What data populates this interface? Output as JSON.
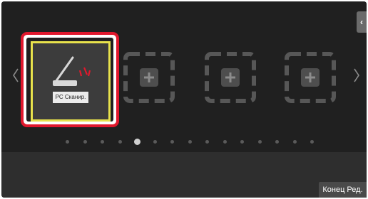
{
  "side_tab": {
    "glyph": "‹",
    "icon": "chevron-left-icon"
  },
  "navigation": {
    "prev_icon": "chevron-left-icon",
    "next_icon": "chevron-right-icon"
  },
  "shortcuts": [
    {
      "label": "PC Сканир.",
      "icon": "scanner-icon",
      "selected": true
    },
    {
      "label": "",
      "icon": "add-icon",
      "selected": false
    },
    {
      "label": "",
      "icon": "add-icon",
      "selected": false
    },
    {
      "label": "",
      "icon": "add-icon",
      "selected": false
    }
  ],
  "pager": {
    "total": 15,
    "current": 5
  },
  "footer": {
    "end_edit_label": "Конец Ред."
  },
  "colors": {
    "highlight": "#e0182d",
    "selection": "#e8e24c",
    "background": "#202020"
  }
}
